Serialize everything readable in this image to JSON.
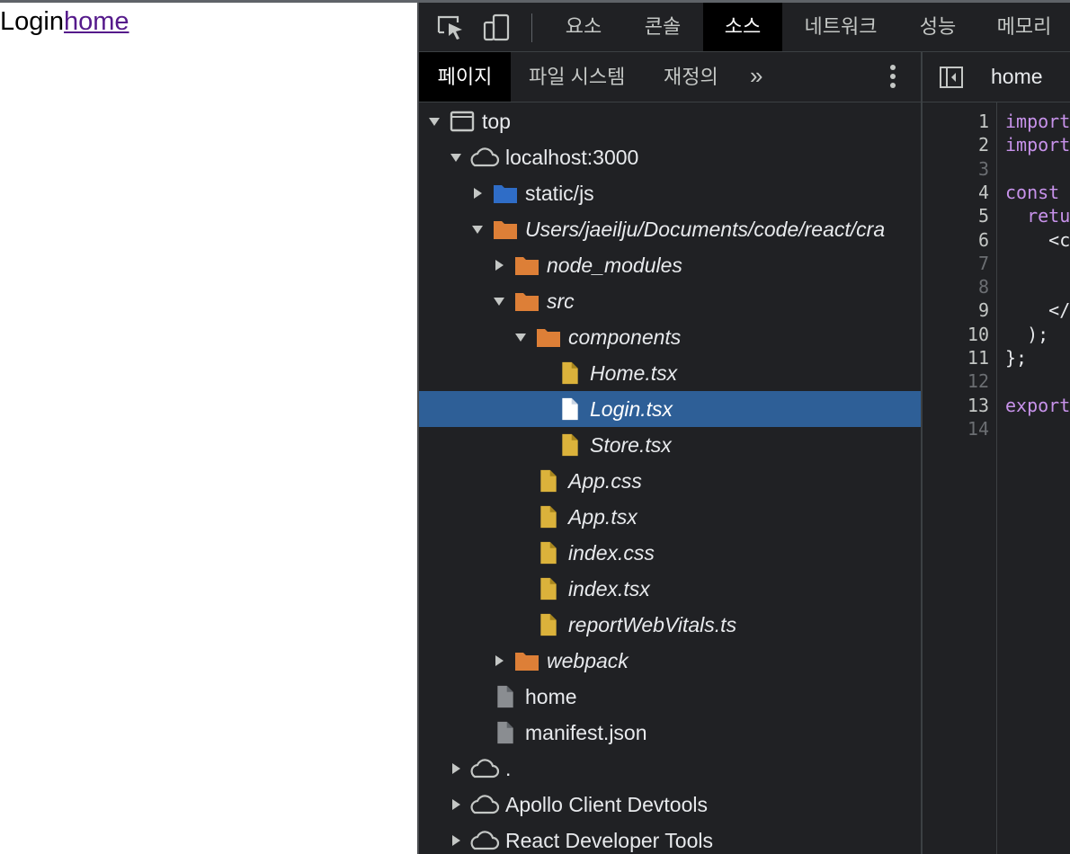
{
  "page": {
    "text": "Login",
    "link": "home"
  },
  "devtools": {
    "main_tabs": [
      {
        "label": "요소"
      },
      {
        "label": "콘솔"
      },
      {
        "label": "소스"
      },
      {
        "label": "네트워크"
      },
      {
        "label": "성능"
      },
      {
        "label": "메모리"
      }
    ],
    "active_tab": "소스",
    "sub_tabs": [
      {
        "label": "페이지"
      },
      {
        "label": "파일 시스템"
      },
      {
        "label": "재정의"
      }
    ],
    "more_glyph": "»",
    "editor_title": "home",
    "tree": [
      {
        "label": "top",
        "type": "frame",
        "expanded": true
      },
      {
        "label": "localhost:3000",
        "type": "cloud",
        "expanded": true
      },
      {
        "label": "static/js",
        "type": "folder-blue",
        "expanded": false
      },
      {
        "label": "Users/jaeilju/Documents/code/react/cra",
        "type": "folder-orange",
        "expanded": true
      },
      {
        "label": "node_modules",
        "type": "folder-orange",
        "expanded": false
      },
      {
        "label": "src",
        "type": "folder-orange",
        "expanded": true
      },
      {
        "label": "components",
        "type": "folder-orange",
        "expanded": true
      },
      {
        "label": "Home.tsx",
        "type": "file-yellow"
      },
      {
        "label": "Login.tsx",
        "type": "file-white",
        "selected": true
      },
      {
        "label": "Store.tsx",
        "type": "file-yellow"
      },
      {
        "label": "App.css",
        "type": "file-yellow"
      },
      {
        "label": "App.tsx",
        "type": "file-yellow"
      },
      {
        "label": "index.css",
        "type": "file-yellow"
      },
      {
        "label": "index.tsx",
        "type": "file-yellow"
      },
      {
        "label": "reportWebVitals.ts",
        "type": "file-yellow"
      },
      {
        "label": "webpack",
        "type": "folder-orange",
        "expanded": false
      },
      {
        "label": "home",
        "type": "file-gray"
      },
      {
        "label": "manifest.json",
        "type": "file-gray"
      },
      {
        "label": ".",
        "type": "cloud",
        "expanded": false
      },
      {
        "label": "Apollo Client Devtools",
        "type": "cloud",
        "expanded": false
      },
      {
        "label": "React Developer Tools",
        "type": "cloud",
        "expanded": false
      }
    ],
    "code_lines": [
      {
        "n": "1",
        "text": "import",
        "color": "#c792ea"
      },
      {
        "n": "2",
        "text": "import",
        "color": "#c792ea"
      },
      {
        "n": "3",
        "text": ""
      },
      {
        "n": "4",
        "text": "const ",
        "color": "#c792ea"
      },
      {
        "n": "5",
        "text": "  retu",
        "color": "#c792ea"
      },
      {
        "n": "6",
        "text": "    <c",
        "color": "#e8eaed"
      },
      {
        "n": "7",
        "text": ""
      },
      {
        "n": "8",
        "text": ""
      },
      {
        "n": "9",
        "text": "    </",
        "color": "#e8eaed"
      },
      {
        "n": "10",
        "text": "  );",
        "color": "#e8eaed"
      },
      {
        "n": "11",
        "text": "};",
        "color": "#e8eaed"
      },
      {
        "n": "12",
        "text": ""
      },
      {
        "n": "13",
        "text": "export",
        "color": "#c792ea"
      },
      {
        "n": "14",
        "text": ""
      }
    ]
  }
}
